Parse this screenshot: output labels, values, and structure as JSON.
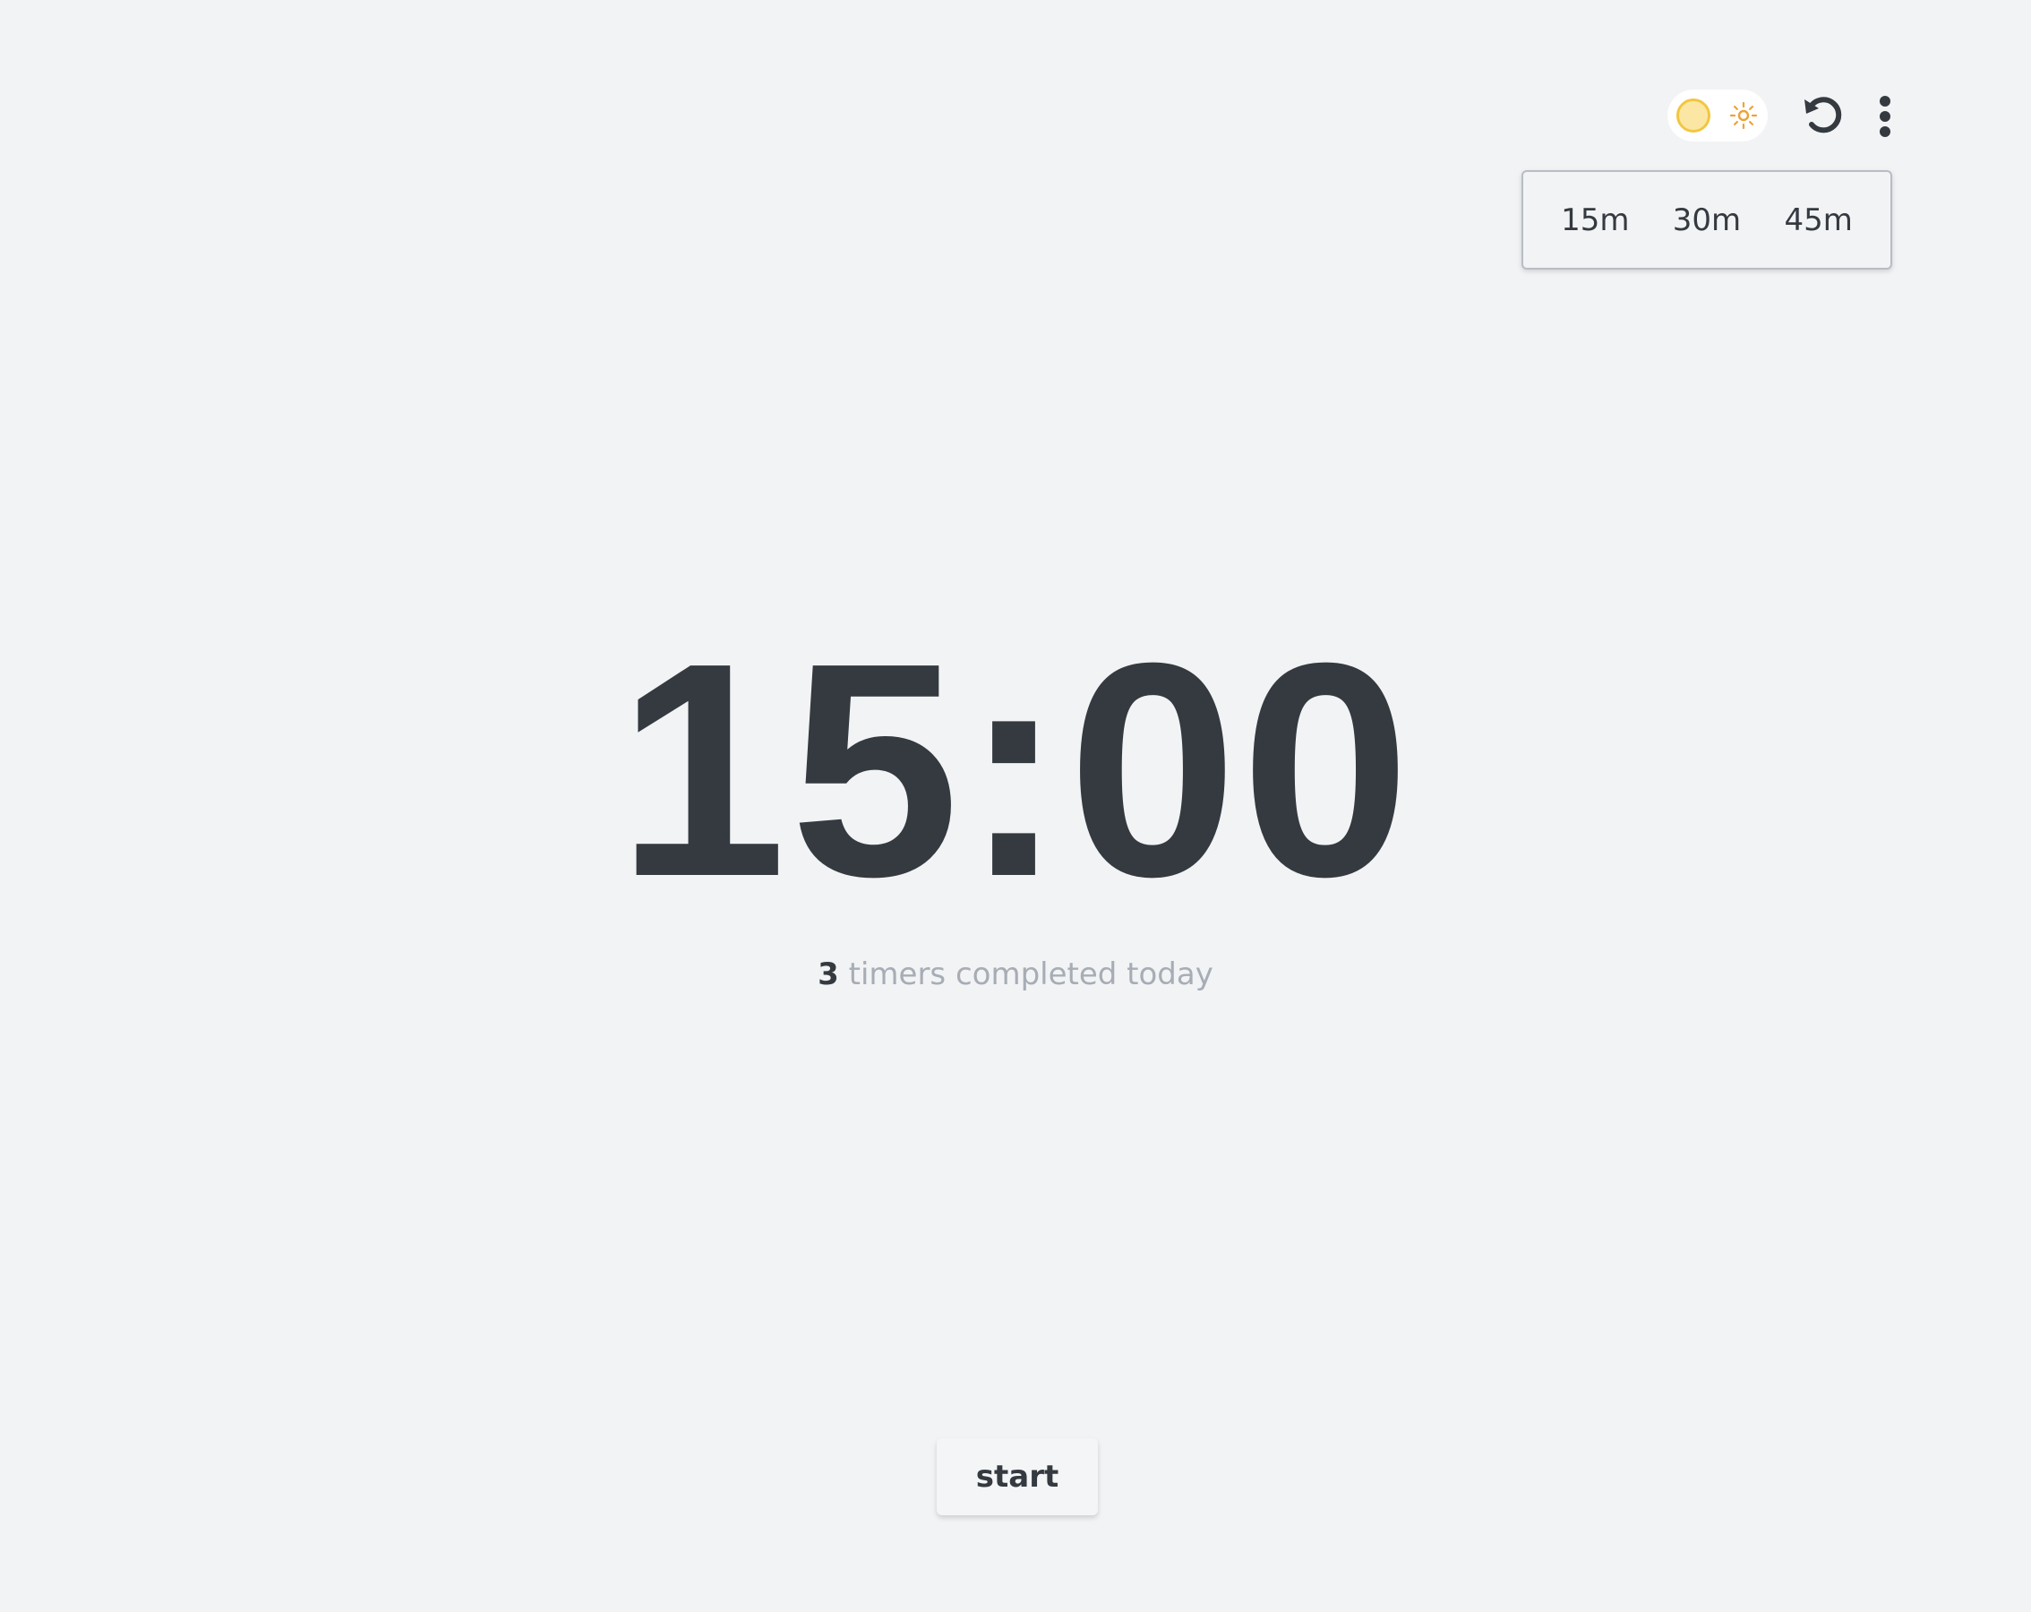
{
  "controls": {
    "theme_toggle": {
      "mode": "light",
      "knob_icon": "moon-icon",
      "indicator_icon": "sun-icon"
    },
    "reset_icon": "reset-icon",
    "more_icon": "more-vertical-icon"
  },
  "presets": {
    "items": [
      "15m",
      "30m",
      "45m"
    ]
  },
  "timer": {
    "display": "15:00"
  },
  "stats": {
    "count": "3",
    "label": "timers completed today"
  },
  "actions": {
    "start_label": "start"
  },
  "colors": {
    "background": "#f2f3f5",
    "text": "#343a40",
    "muted": "#a7adb5",
    "accent_yellow": "#f3c63f",
    "sun_orange": "#f0a233"
  }
}
